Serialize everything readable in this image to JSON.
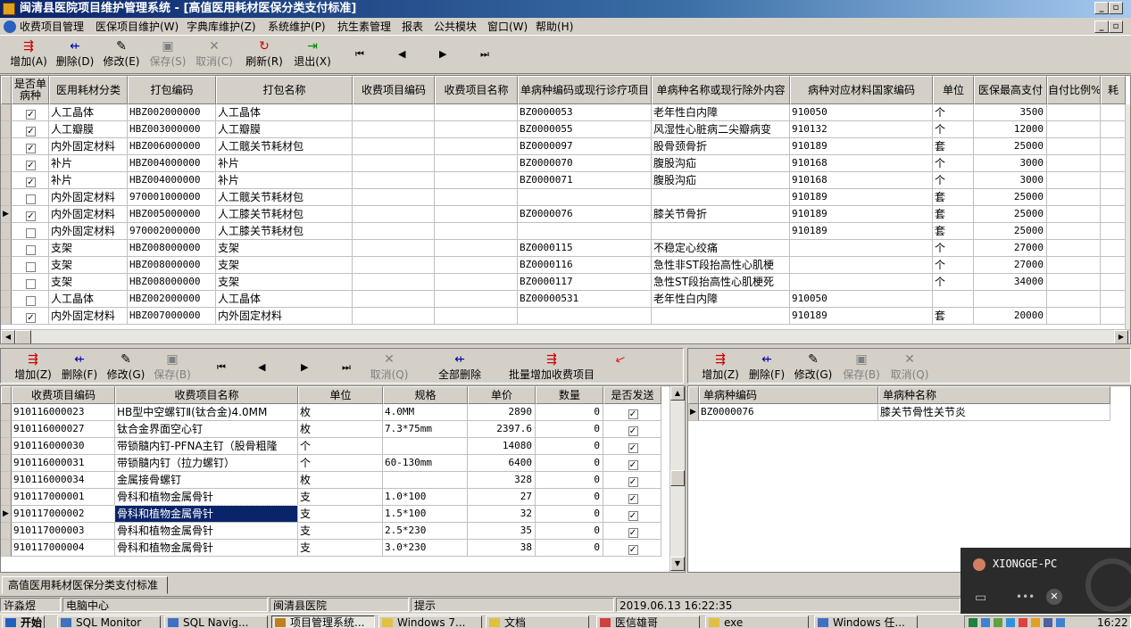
{
  "window": {
    "title": "闽清县医院项目维护管理系统 - [高值医用耗材医保分类支付标准]"
  },
  "menu": [
    "收费项目管理",
    "医保项目维护(W)",
    "字典库维护(Z)",
    "系统维护(P)",
    "抗生素管理",
    "报表",
    "公共模块",
    "窗口(W)",
    "帮助(H)"
  ],
  "toolbar": {
    "add": "增加(A)",
    "delete": "删除(D)",
    "edit": "修改(E)",
    "save": "保存(S)",
    "cancel": "取消(C)",
    "refresh": "刷新(R)",
    "exit": "退出(X)"
  },
  "top_table": {
    "columns": [
      "是否单病种",
      "医用耗材分类",
      "打包编码",
      "打包名称",
      "收费项目编码",
      "收费项目名称",
      "单病种编码或现行诊疗项目",
      "单病种名称或现行除外内容",
      "病种对应材料国家编码",
      "单位",
      "医保最高支付",
      "自付比例%",
      "耗"
    ],
    "rows": [
      {
        "check": "☑",
        "cat": "人工晶体",
        "code": "HBZ002000000",
        "name": "人工晶体",
        "dcode": "BZ0000053",
        "dname": "老年性白内障",
        "nat": "910050",
        "unit": "个",
        "max": "3500"
      },
      {
        "check": "☑",
        "cat": "人工瓣膜",
        "code": "HBZ003000000",
        "name": "人工瓣膜",
        "dcode": "BZ0000055",
        "dname": "风湿性心脏病二尖瓣病变",
        "nat": "910132",
        "unit": "个",
        "max": "12000"
      },
      {
        "check": "☑",
        "cat": "内外固定材料",
        "code": "HBZ006000000",
        "name": "人工髋关节耗材包",
        "dcode": "BZ0000097",
        "dname": "股骨颈骨折",
        "nat": "910189",
        "unit": "套",
        "max": "25000"
      },
      {
        "check": "☑",
        "cat": "补片",
        "code": "HBZ004000000",
        "name": "补片",
        "dcode": "BZ0000070",
        "dname": "腹股沟疝",
        "nat": "910168",
        "unit": "个",
        "max": "3000"
      },
      {
        "check": "☑",
        "cat": "补片",
        "code": "HBZ004000000",
        "name": "补片",
        "dcode": "BZ0000071",
        "dname": "腹股沟疝",
        "nat": "910168",
        "unit": "个",
        "max": "3000"
      },
      {
        "check": "☐",
        "cat": "内外固定材料",
        "code": "970001000000",
        "name": "人工髋关节耗材包",
        "dcode": "",
        "dname": "",
        "nat": "910189",
        "unit": "套",
        "max": "25000"
      },
      {
        "check": "☑",
        "cat": "内外固定材料",
        "code": "HBZ005000000",
        "name": "人工膝关节耗材包",
        "dcode": "BZ0000076",
        "dname": "膝关节骨折",
        "nat": "910189",
        "unit": "套",
        "max": "25000"
      },
      {
        "check": "☐",
        "cat": "内外固定材料",
        "code": "970002000000",
        "name": "人工膝关节耗材包",
        "dcode": "",
        "dname": "",
        "nat": "910189",
        "unit": "套",
        "max": "25000"
      },
      {
        "check": "☐",
        "cat": "支架",
        "code": "HBZ008000000",
        "name": "支架",
        "dcode": "BZ0000115",
        "dname": "不稳定心绞痛",
        "nat": "",
        "unit": "个",
        "max": "27000"
      },
      {
        "check": "☐",
        "cat": "支架",
        "code": "HBZ008000000",
        "name": "支架",
        "dcode": "BZ0000116",
        "dname": "急性非ST段抬高性心肌梗",
        "nat": "",
        "unit": "个",
        "max": "27000"
      },
      {
        "check": "☐",
        "cat": "支架",
        "code": "HBZ008000000",
        "name": "支架",
        "dcode": "BZ0000117",
        "dname": "急性ST段抬高性心肌梗死",
        "nat": "",
        "unit": "个",
        "max": "34000"
      },
      {
        "check": "☐",
        "cat": "人工晶体",
        "code": "HBZ002000000",
        "name": "人工晶体",
        "dcode": "BZ00000531",
        "dname": "老年性白内障",
        "nat": "910050",
        "unit": "",
        "max": ""
      },
      {
        "check": "☑",
        "cat": "内外固定材料",
        "code": "HBZ007000000",
        "name": "内外固定材料",
        "dcode": "",
        "dname": "",
        "nat": "910189",
        "unit": "套",
        "max": "20000"
      }
    ]
  },
  "bottom_left_toolbar": {
    "add": "增加(Z)",
    "delete": "删除(F)",
    "edit": "修改(G)",
    "save": "保存(B)",
    "cancel": "取消(Q)",
    "delete_all": "全部删除",
    "batch_add": "批量增加收费项目"
  },
  "bottom_right_toolbar": {
    "add": "增加(Z)",
    "delete": "删除(F)",
    "edit": "修改(G)",
    "save": "保存(B)",
    "cancel": "取消(Q)"
  },
  "items_table": {
    "columns": [
      "收费项目编码",
      "收费项目名称",
      "单位",
      "规格",
      "单价",
      "数量",
      "是否发送"
    ],
    "rows": [
      {
        "code": "910116000023",
        "name": "HB型中空螺钉Ⅱ(钛合金)4.0MM",
        "unit": "枚",
        "spec": "4.0MM",
        "price": "2890",
        "qty": "0",
        "send": "☑"
      },
      {
        "code": "910116000027",
        "name": "钛合金界面空心钉",
        "unit": "枚",
        "spec": "7.3*75mm",
        "price": "2397.6",
        "qty": "0",
        "send": "☑"
      },
      {
        "code": "910116000030",
        "name": "带锁髓内钉-PFNA主钉（股骨粗隆",
        "unit": "个",
        "spec": "",
        "price": "14080",
        "qty": "0",
        "send": "☑"
      },
      {
        "code": "910116000031",
        "name": "带锁髓内钉（拉力螺钉）",
        "unit": "个",
        "spec": "60-130mm",
        "price": "6400",
        "qty": "0",
        "send": "☑"
      },
      {
        "code": "910116000034",
        "name": "金属接骨螺钉",
        "unit": "枚",
        "spec": "",
        "price": "328",
        "qty": "0",
        "send": "☑"
      },
      {
        "code": "910117000001",
        "name": "骨科和植物金属骨针",
        "unit": "支",
        "spec": "1.0*100",
        "price": "27",
        "qty": "0",
        "send": "☑"
      },
      {
        "code": "910117000002",
        "name": "骨科和植物金属骨针",
        "unit": "支",
        "spec": "1.5*100",
        "price": "32",
        "qty": "0",
        "send": "☑"
      },
      {
        "code": "910117000003",
        "name": "骨科和植物金属骨针",
        "unit": "支",
        "spec": "2.5*230",
        "price": "35",
        "qty": "0",
        "send": "☑"
      },
      {
        "code": "910117000004",
        "name": "骨科和植物金属骨针",
        "unit": "支",
        "spec": "3.0*230",
        "price": "38",
        "qty": "0",
        "send": "☑"
      }
    ]
  },
  "disease_table": {
    "columns": [
      "单病种编码",
      "单病种名称"
    ],
    "rows": [
      {
        "code": "BZ0000076",
        "name": "膝关节骨性关节炎"
      }
    ]
  },
  "tab_label": "高值医用耗材医保分类支付标准",
  "status": {
    "user": "许淼煜",
    "dept": "电脑中心",
    "hospital": "闽清县医院",
    "hint": "提示",
    "datetime": "2019.06.13  16:22:35"
  },
  "popup": {
    "pc_name": "XIONGGE-PC"
  },
  "taskbar": {
    "start": "开始",
    "tasks": [
      "SQL Monitor",
      "SQL Navig...",
      "项目管理系统...",
      "Windows 7...",
      "文档",
      "医信雄哥",
      "exe",
      "Windows 任..."
    ],
    "clock": "16:22"
  },
  "colors": {
    "title_start": "#0a246a",
    "title_end": "#a6caf0",
    "selection": "#0a246a",
    "arrow_red": "#e02020"
  }
}
